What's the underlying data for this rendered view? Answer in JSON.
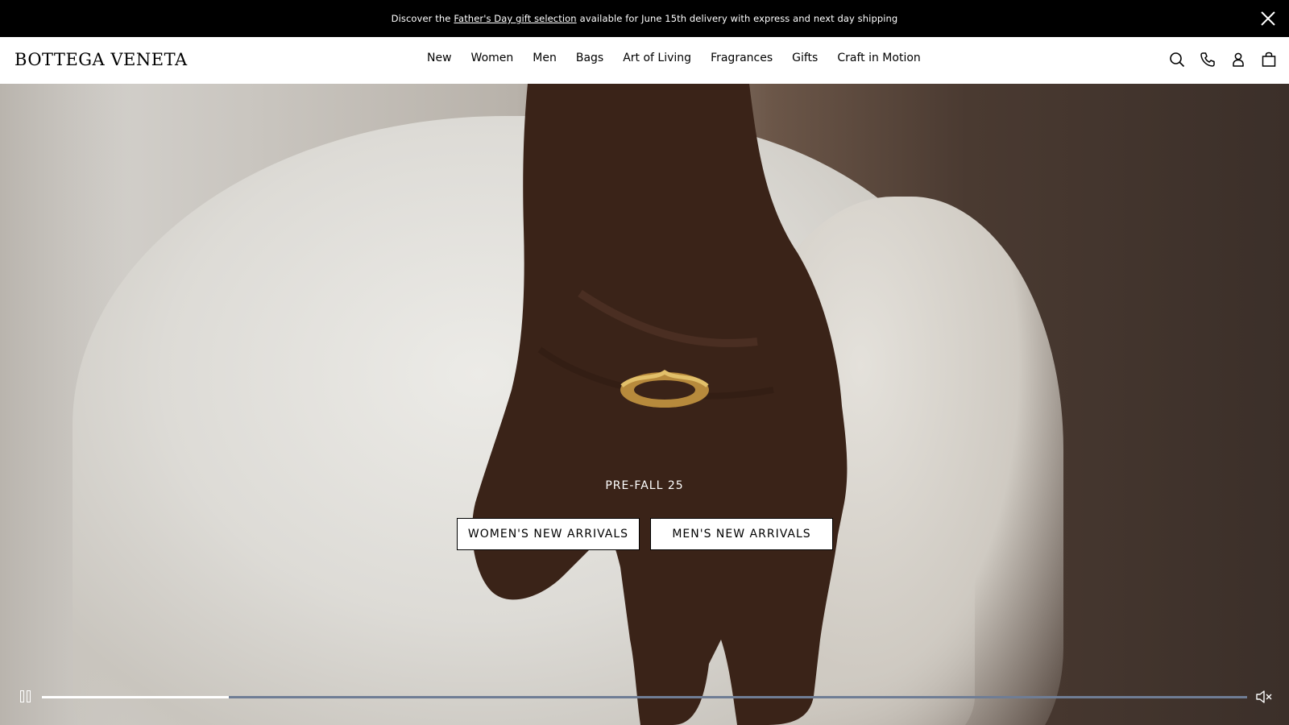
{
  "announcement": {
    "prefix": "Discover the",
    "link": "Father's Day gift selection",
    "suffix": "available for June 15th delivery with express and next day shipping",
    "close_icon": "close-icon"
  },
  "header": {
    "logo": "BOTTEGA VENETA",
    "nav": [
      "New",
      "Women",
      "Men",
      "Bags",
      "Art of Living",
      "Fragrances",
      "Gifts",
      "Craft in Motion"
    ],
    "utilities": [
      "search-icon",
      "phone-icon",
      "account-icon",
      "bag-icon"
    ]
  },
  "hero": {
    "eyebrow": "PRE-FALL 25",
    "cta_women": "WOMEN'S NEW ARRIVALS",
    "cta_men": "MEN'S NEW ARRIVALS"
  },
  "video": {
    "progress": 0.155,
    "pause_icon": "pause-icon",
    "mute_icon": "muted-speaker-icon",
    "track_color": "#6f7d95",
    "fill_color": "#ffffff"
  },
  "colors": {
    "announcement_bg": "#000000",
    "header_bg": "#ffffff"
  }
}
